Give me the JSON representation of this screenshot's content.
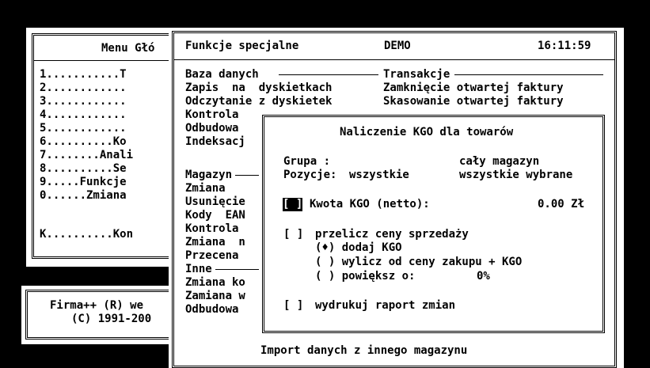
{
  "colors": {
    "screen": "#000000",
    "window": "#ffffff",
    "text": "#000000"
  },
  "main_menu": {
    "title": "Menu Głó",
    "items": [
      "1...........T",
      "2............",
      "3............",
      "4............",
      "5............",
      "6..........Ko",
      "7........Anali",
      "8..........Se",
      "9.....Funkcje",
      "0......Zmiana",
      "K..........Kon"
    ]
  },
  "company": {
    "line1": "Firma++ (R) we",
    "line2": "(C) 1991-200"
  },
  "special": {
    "title": "Funkcje specjalne",
    "mode": "DEMO",
    "time": "16:11:59",
    "left_col": [
      "Baza danych",
      "Zapis  na  dyskietkach",
      "Odczytanie z dyskietek",
      "Kontrola",
      "Odbudowa",
      "Indeksacj",
      "",
      "Magazyn",
      "Zmiana",
      "Usunięcie",
      "Kody  EAN",
      "Kontrola",
      "Zmiana  n",
      "Przecena",
      "Inne",
      "Zmiana ko",
      "Zamiana w",
      "Odbudowa"
    ],
    "right_col": [
      "Transakcje",
      "Zamknięcie otwartej faktury",
      "Skasowanie otwartej faktury"
    ],
    "bottom": "Import danych z innego magazynu"
  },
  "dialog": {
    "title": "Naliczenie KGO dla towarów",
    "group_label": "Grupa :",
    "group_value": "cały magazyn",
    "positions_label": "Pozycje:",
    "positions_opt1": "wszystkie",
    "positions_opt2": "wszystkie wybrane",
    "kgo_check": "[ ]",
    "kgo_label": "Kwota KGO (netto):",
    "kgo_value": "0.00 Zł",
    "recalc_check": "[ ]",
    "recalc_label": "przelicz ceny sprzedaży",
    "radio1": "(♦) dodaj KGO",
    "radio2": "( ) wylicz od ceny zakupu + KGO",
    "radio3_label": "( ) powiększ o:",
    "radio3_value": "0%",
    "print_check": "[ ]",
    "print_label": "wydrukuj raport zmian"
  }
}
